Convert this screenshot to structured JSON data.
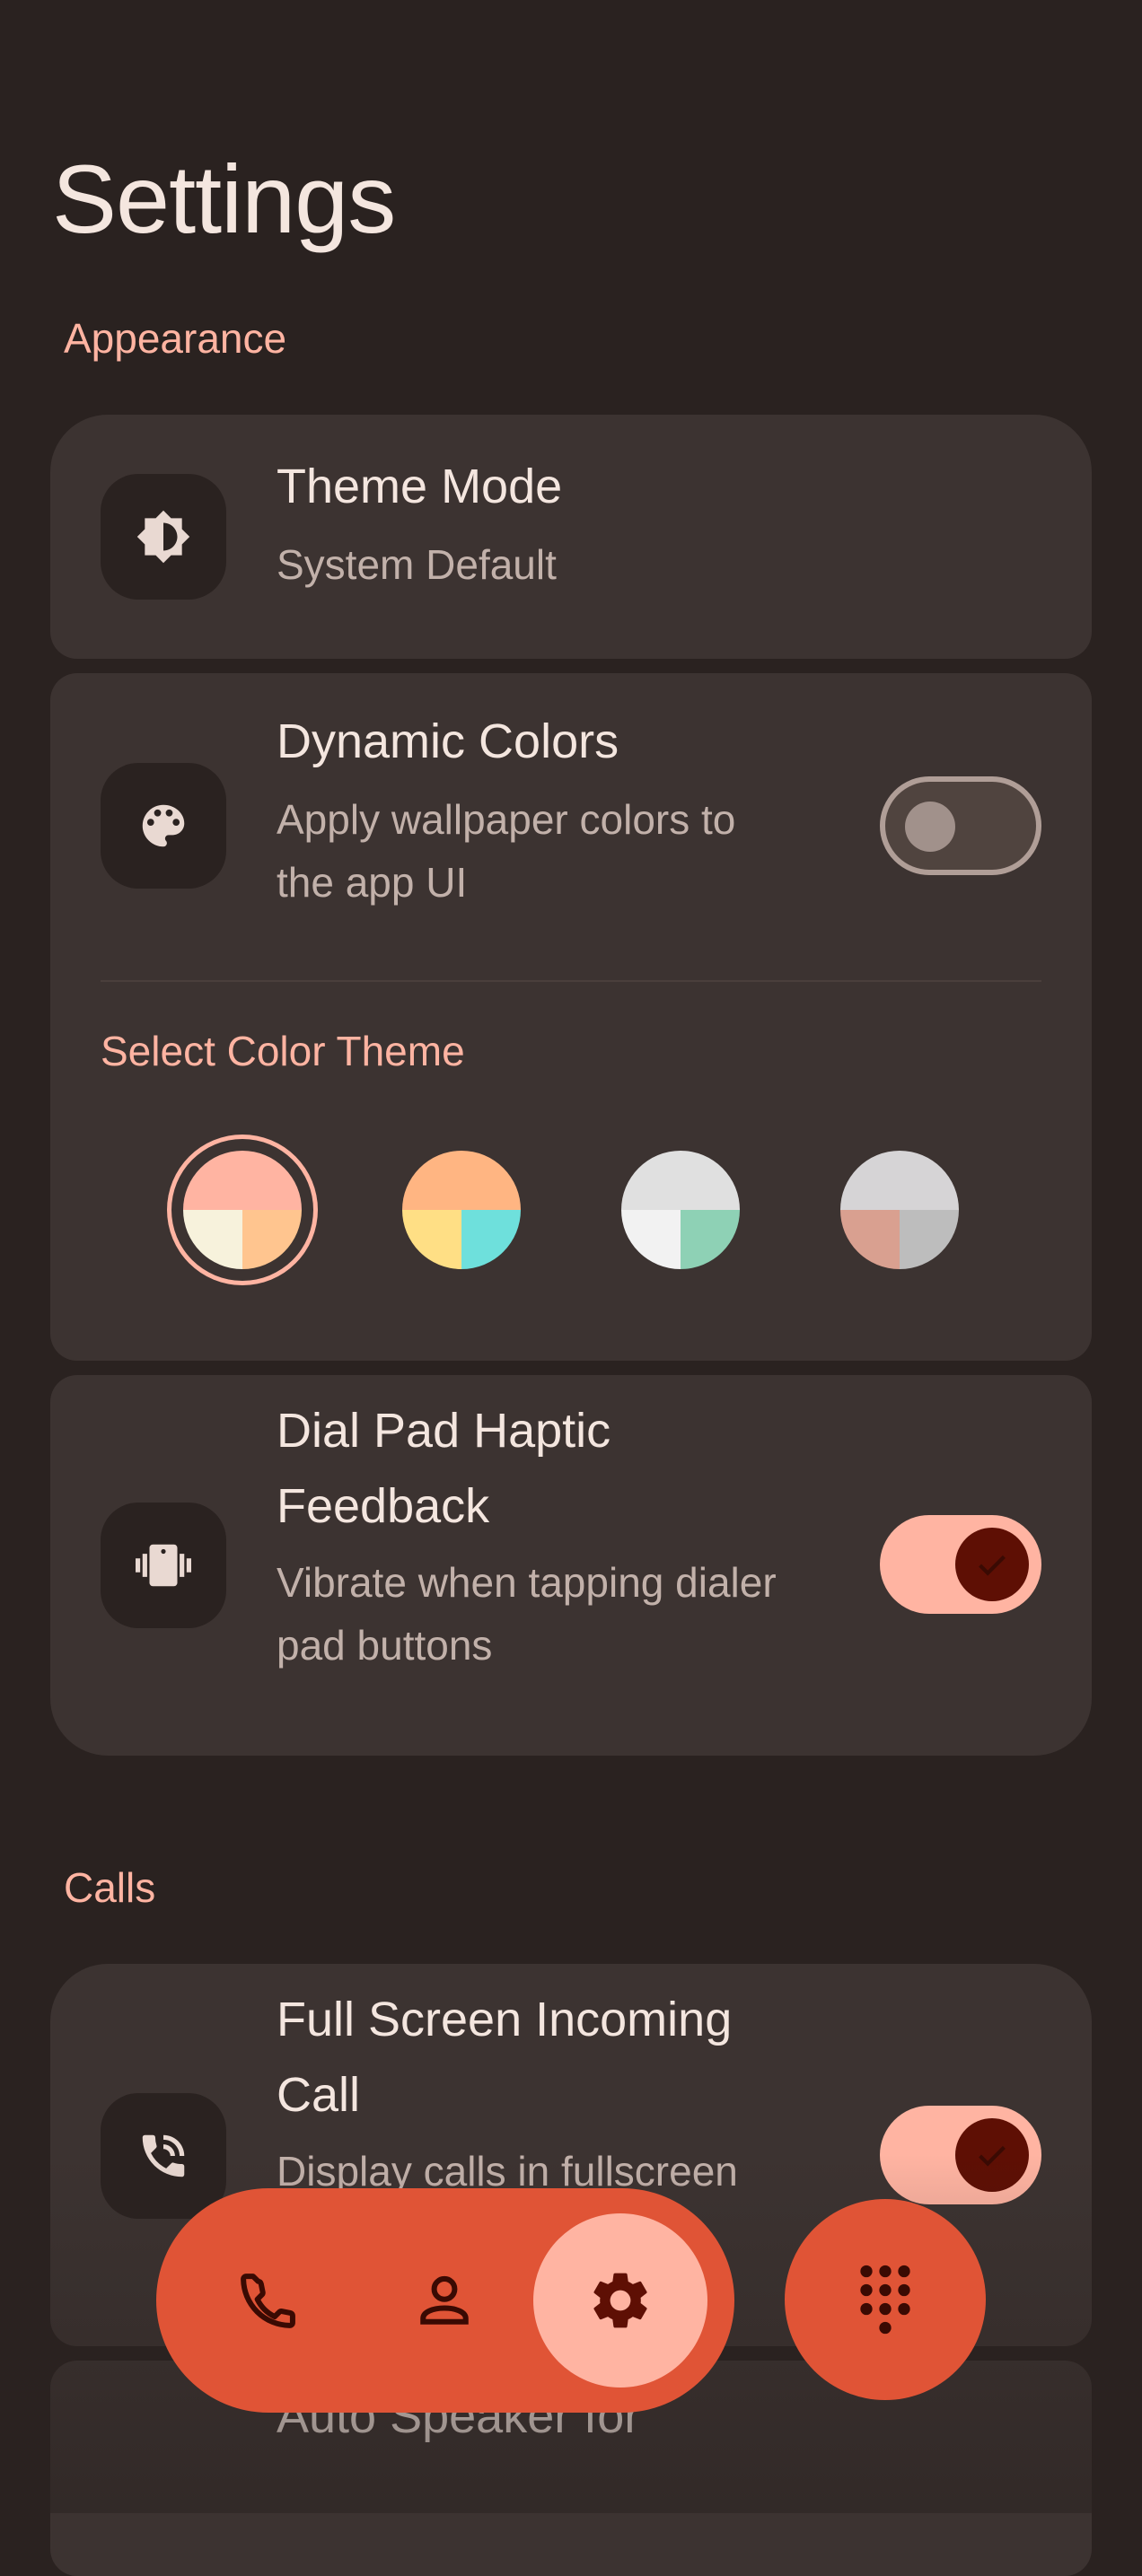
{
  "page": {
    "title": "Settings"
  },
  "sections": {
    "appearance": "Appearance",
    "calls": "Calls"
  },
  "theme_mode": {
    "title": "Theme Mode",
    "subtitle": "System Default",
    "icon": "brightness-icon"
  },
  "dynamic_colors": {
    "title": "Dynamic Colors",
    "subtitle_line1": "Apply wallpaper colors to",
    "subtitle_line2": "the app UI",
    "enabled": false,
    "icon": "palette-icon"
  },
  "color_theme": {
    "label": "Select Color Theme",
    "selected_index": 0,
    "swatches": [
      {
        "top": "#ffb4a2",
        "bottom_left": "#f7f2dc",
        "bottom_right": "#ffc58f"
      },
      {
        "top": "#ffb582",
        "bottom_left": "#ffdf85",
        "bottom_right": "#6ee0dc"
      },
      {
        "top": "#e0e0e0",
        "bottom_left": "#f2f2f2",
        "bottom_right": "#8ed1b5"
      },
      {
        "top": "#d6d4d6",
        "bottom_left": "#d9a090",
        "bottom_right": "#bdbdbd"
      }
    ]
  },
  "haptic": {
    "title_line1": "Dial Pad Haptic",
    "title_line2": "Feedback",
    "subtitle_line1": "Vibrate when tapping dialer",
    "subtitle_line2": "pad buttons",
    "enabled": true,
    "icon": "vibrate-icon"
  },
  "fullscreen_call": {
    "title_line1": "Full Screen Incoming",
    "title_line2": "Call",
    "subtitle_partial": "Display calls in fullscreen",
    "enabled": true,
    "icon": "phone-in-talk-icon"
  },
  "auto_speaker": {
    "title_partial": "Auto Speaker for"
  },
  "nav": {
    "items": [
      "phone-icon",
      "contacts-icon",
      "settings-icon"
    ],
    "active_index": 2
  },
  "fab": {
    "icon": "dialpad-icon"
  },
  "colors": {
    "accent": "#ffb4a2",
    "nav": "#e05436",
    "background": "#2a2220",
    "card": "#3c3331"
  }
}
